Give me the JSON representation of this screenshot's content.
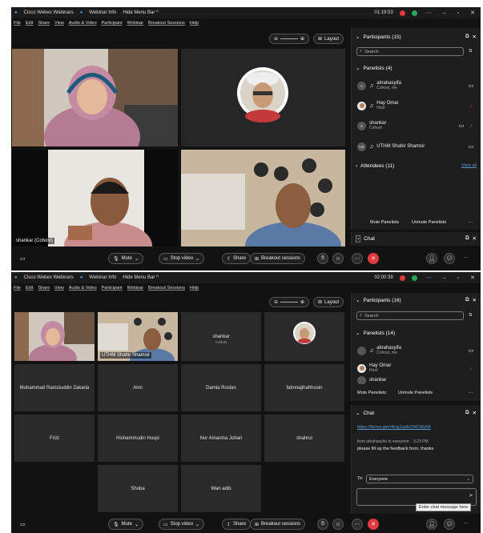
{
  "shot1": {
    "title": "Cisco Webex Webinars",
    "info": "Webinar Info",
    "hide_menu": "Hide Menu Bar",
    "timer": "01:19:53",
    "menu": [
      "File",
      "Edit",
      "Share",
      "View",
      "Audio & Video",
      "Participant",
      "Webinar",
      "Breakout Sessions",
      "Help"
    ],
    "layout_label": "Layout",
    "tile_label_shankar": "shankar (Cohost)",
    "participants_header": "Participants (15)",
    "search_placeholder": "Search",
    "panelists_header": "Panelists (4)",
    "panelists": [
      {
        "initials": "A",
        "name": "atirahasyifa",
        "role": "Cohost, me"
      },
      {
        "initials": "",
        "name": "Hay Omar",
        "role": "Host"
      },
      {
        "initials": "S",
        "name": "shankar",
        "role": "Cohost"
      },
      {
        "initials": "US",
        "name": "UTHM Shahir Shamsir",
        "role": ""
      }
    ],
    "attendees_header": "Attendees (11)",
    "view_all": "View all",
    "mute_panelists": "Mute Panelists",
    "unmute_panelists": "Unmute Panelists",
    "chat_header": "Chat",
    "mute": "Mute",
    "stop_video": "Stop video",
    "share": "Share",
    "breakout": "Breakout sessions"
  },
  "shot2": {
    "title": "Cisco Webex Webinars",
    "info": "Webinar Info",
    "hide_menu": "Hide Menu Bar",
    "timer": "02:00:39",
    "menu": [
      "File",
      "Edit",
      "Share",
      "View",
      "Audio & Video",
      "Participant",
      "Webinar",
      "Breakout Sessions",
      "Help"
    ],
    "layout_label": "Layout",
    "tile_uthm": "UTHM Shahir Shamsir",
    "tile_shankar": "shankar",
    "tile_shankar_role": "Cohost",
    "grid_names": [
      "Muhammad Ramziuddin Zakaria",
      "Aimi",
      "Damia Roslan",
      "fatinnajihahhusin",
      "Frizt",
      "Hishammudin Huspi",
      "Nur Amanina Johari",
      "shahrul",
      "Shoba",
      "Wan adib"
    ],
    "participants_header": "Participants (16)",
    "search_placeholder": "Search",
    "panelists_header": "Panelists (14)",
    "panelists": [
      {
        "name": "atirahasyifa",
        "role": "Cohost, me"
      },
      {
        "name": "Hay Omar",
        "role": "Host"
      },
      {
        "name": "shankar",
        "role": ""
      }
    ],
    "mute_panelists": "Mute Panelists",
    "unmute_panelists": "Unmute Panelists",
    "chat_header": "Chat",
    "chat_link": "https://forms.gle/rNog1qdbi7MCMy6A",
    "chat_from": "from atirahasyifa to everyone:",
    "chat_time": "3:23 PM",
    "chat_message": "please fill up the feedback form, thanks",
    "to_label": "To:",
    "to_value": "Everyone",
    "chat_placeholder": "Enter chat message here",
    "mute": "Mute",
    "stop_video": "Stop video",
    "share": "Share",
    "breakout": "Breakout sessions"
  },
  "colors": {
    "accent": "#6aa6e8",
    "end_red": "#e0393e",
    "link": "#5b9bd5"
  }
}
